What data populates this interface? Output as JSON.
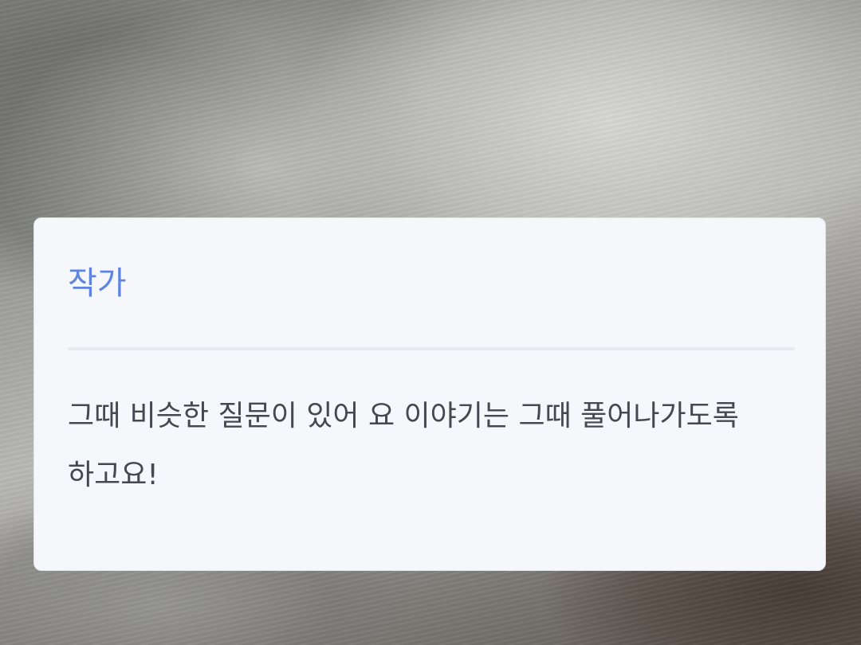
{
  "popup": {
    "title": "작가",
    "message": "그때 비슷한 질문이 있어 요 이야기는 그때 풀어나가도록 하고요!"
  },
  "colors": {
    "title": "#5f83e0",
    "body_text": "#45484f",
    "card_background": "#f5f7fa",
    "divider": "#e8eaf0"
  }
}
